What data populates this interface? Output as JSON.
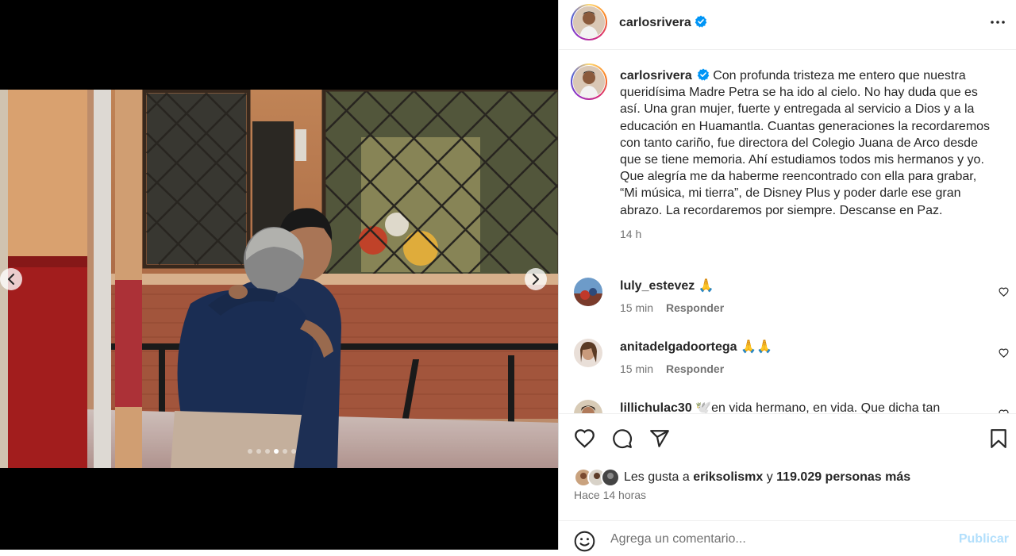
{
  "post": {
    "username": "carlosrivera",
    "verified": true,
    "more_icon": "more-horizontal-icon",
    "caption": "Con profunda tristeza me entero que nuestra queridísima Madre Petra se ha ido al cielo. No hay duda que es así. Una gran mujer, fuerte y entregada al servicio a Dios y a la educación en Huamantla. Cuantas generaciones la recordaremos con tanto cariño, fue directora del Colegio Juana de Arco desde que se tiene memoria. Ahí estudiamos todos mis hermanos y yo. Que alegría me da haberme reencontrado con ella para grabar, “Mi música, mi tierra”, de Disney Plus y poder darle ese gran abrazo. La recordaremos por siempre. Descanse en Paz.",
    "caption_time": "14 h"
  },
  "carousel": {
    "slides": 6,
    "active_index": 3,
    "prev_icon": "chevron-left-icon",
    "next_icon": "chevron-right-icon"
  },
  "comments": [
    {
      "username": "luly_estevez",
      "text": "🙏",
      "time": "15 min",
      "reply": "Responder"
    },
    {
      "username": "anitadelgadoortega",
      "text": "🙏🙏",
      "time": "15 min",
      "reply": "Responder"
    },
    {
      "username": "lillichulac30",
      "text": "🕊️en vida hermano, en vida. Que dicha tan",
      "time": "",
      "reply": ""
    }
  ],
  "actions": {
    "like_icon": "heart-icon",
    "comment_icon": "comment-bubble-icon",
    "share_icon": "paper-plane-icon",
    "save_icon": "bookmark-icon"
  },
  "likes": {
    "prefix": "Les gusta a",
    "user": "eriksolismx",
    "connector": "y",
    "others": "119.029 personas más"
  },
  "posted_ago": "Hace 14 horas",
  "comment_box": {
    "placeholder": "Agrega un comentario...",
    "publish_label": "Publicar",
    "emoji_icon": "smiley-icon"
  },
  "colors": {
    "verified": "#0095f6",
    "publish_disabled": "#b2dffc",
    "secondary_text": "#737373"
  }
}
